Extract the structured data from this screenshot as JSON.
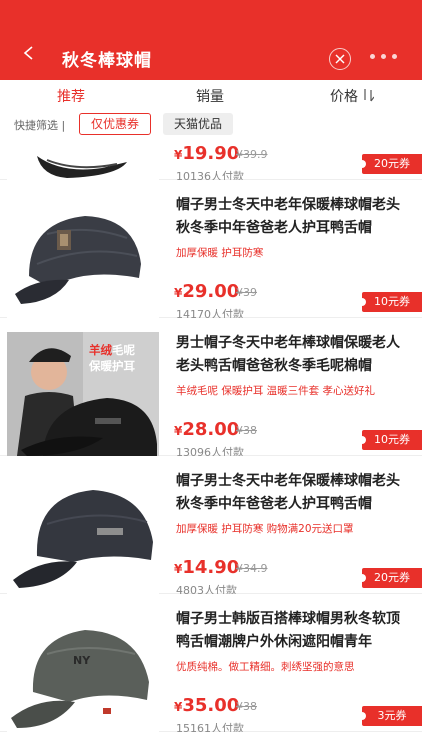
{
  "header": {
    "title": "秋冬棒球帽",
    "back_icon": "chevron-left-icon",
    "close_icon": "close-circle-icon",
    "more_icon": "more-dots-icon"
  },
  "sort_tabs": [
    {
      "label": "推荐",
      "active": true
    },
    {
      "label": "销量",
      "active": false
    },
    {
      "label": "价格",
      "active": false
    }
  ],
  "filter": {
    "label": "快捷筛选 |",
    "chips": [
      "仅优惠券",
      "天猫优品"
    ]
  },
  "products": [
    {
      "title": "",
      "promo": "",
      "price_symbol": "¥",
      "price": "19.90",
      "original_price": "¥39.9",
      "sales": "10136人付款",
      "coupon": "20元券"
    },
    {
      "title": "帽子男士冬天中老年保暖棒球帽老头秋冬季中年爸爸老人护耳鸭舌帽",
      "promo": "加厚保暖 护耳防寒",
      "price_symbol": "¥",
      "price": "29.00",
      "original_price": "¥39",
      "sales": "14170人付款",
      "coupon": "10元券"
    },
    {
      "title": "男士帽子冬天中老年棒球帽保暖老人老头鸭舌帽爸爸秋冬季毛呢棉帽",
      "promo": "羊绒毛呢 保暖护耳 温暖三件套 孝心送好礼",
      "price_symbol": "¥",
      "price": "28.00",
      "original_price": "¥38",
      "sales": "13096人付款",
      "coupon": "10元券",
      "badge_red": "羊绒",
      "badge_white1": "毛呢",
      "badge_white2": "保暖护耳"
    },
    {
      "title": "帽子男士冬天中老年保暖棒球帽老头秋冬季中年爸爸老人护耳鸭舌帽",
      "promo": "加厚保暖 护耳防寒 购物满20元送口罩",
      "price_symbol": "¥",
      "price": "14.90",
      "original_price": "¥34.9",
      "sales": "4803人付款",
      "coupon": "20元券"
    },
    {
      "title": "帽子男士韩版百搭棒球帽男秋冬软顶鸭舌帽潮牌户外休闲遮阳帽青年",
      "promo": "优质纯棉。做工精细。刺绣坚强的意思",
      "price_symbol": "¥",
      "price": "35.00",
      "original_price": "¥38",
      "sales": "15161人付款",
      "coupon": "3元券"
    }
  ]
}
